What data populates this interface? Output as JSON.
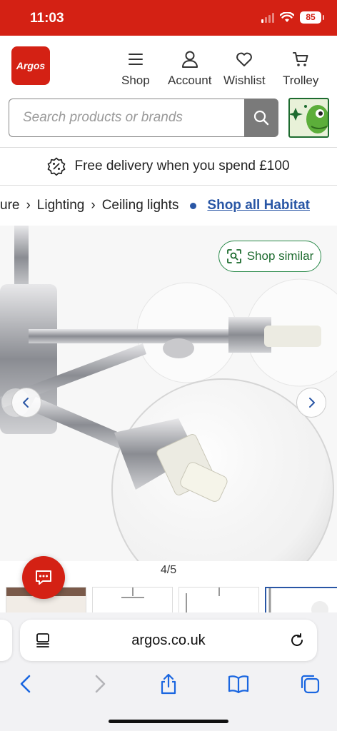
{
  "status_bar": {
    "time": "11:03",
    "battery": "85"
  },
  "header": {
    "logo_text": "Argos",
    "nav": [
      {
        "label": "Shop",
        "icon": "menu-icon"
      },
      {
        "label": "Account",
        "icon": "user-icon"
      },
      {
        "label": "Wishlist",
        "icon": "heart-icon"
      },
      {
        "label": "Trolley",
        "icon": "trolley-icon"
      }
    ]
  },
  "search": {
    "placeholder": "Search products or brands"
  },
  "delivery_banner": {
    "text": "Free delivery when you spend £100"
  },
  "breadcrumb": {
    "items": [
      "ure",
      "Lighting",
      "Ceiling lights"
    ],
    "link": "Shop all Habitat"
  },
  "gallery": {
    "shop_similar_label": "Shop similar",
    "pager": "4/5",
    "current_index": 4,
    "total": 5
  },
  "browser": {
    "url": "argos.co.uk"
  },
  "colors": {
    "brand_red": "#d42114",
    "link_blue": "#2956a5",
    "similar_green": "#1d6b2f"
  }
}
